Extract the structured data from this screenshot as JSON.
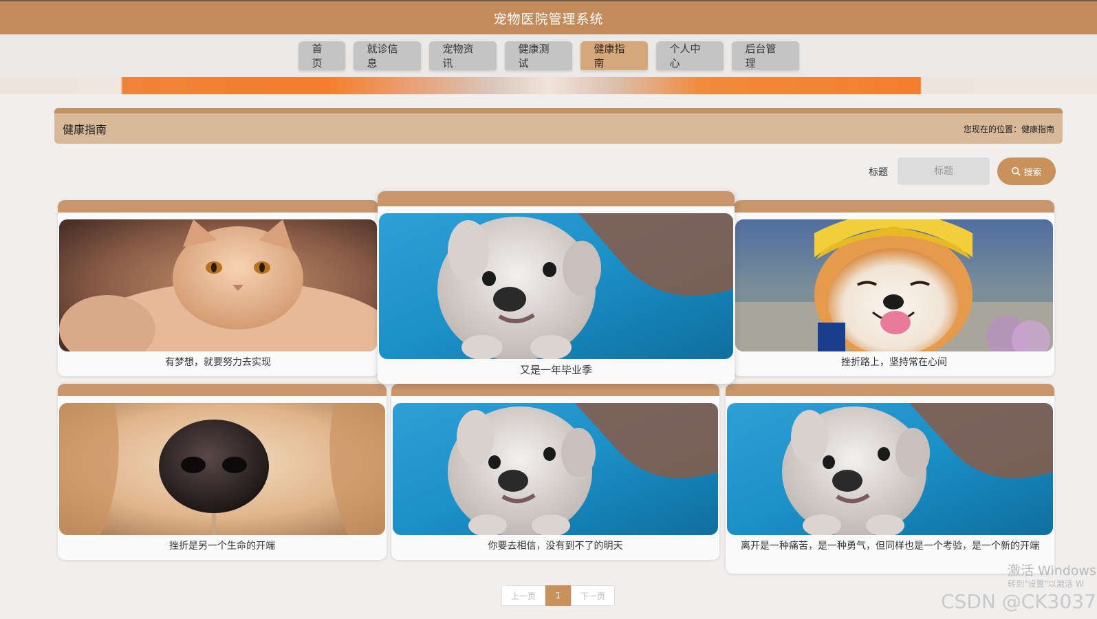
{
  "app": {
    "title": "宠物医院管理系统"
  },
  "nav": {
    "items": [
      "首页",
      "就诊信息",
      "宠物资讯",
      "健康测试",
      "健康指南",
      "个人中心",
      "后台管理"
    ],
    "active_index": 4
  },
  "section": {
    "title": "健康指南",
    "breadcrumb_prefix": "您现在的位置：",
    "breadcrumb_current": "健康指南"
  },
  "search": {
    "label": "标题",
    "placeholder": "标题",
    "button_label": "搜索"
  },
  "cards": [
    {
      "caption": "有梦想，就要努力去实现",
      "image": "orange-cat-photo"
    },
    {
      "caption": "又是一年毕业季",
      "image": "white-puppy-photo"
    },
    {
      "caption": "挫折路上，坚持常在心间",
      "image": "shiba-yellow-hat-photo"
    },
    {
      "caption": "挫折是另一个生命的开端",
      "image": "golden-retriever-nose-photo"
    },
    {
      "caption": "你要去相信，没有到不了的明天",
      "image": "white-puppy-photo"
    },
    {
      "caption": "离开是一种痛苦，是一种勇气，但同样也是一个考验，是一个新的开端",
      "image": "white-puppy-photo"
    }
  ],
  "pagination": {
    "prev": "上一页",
    "current": "1",
    "next": "下一页"
  },
  "overlay": {
    "activate_title": "激活 Windows",
    "activate_sub": "转到\"设置\"以激活 W",
    "watermark": "CSDN @CK3037"
  },
  "colors": {
    "primary": "#c48b5a",
    "nav_active": "#d4a87c",
    "header_band": "#d8b999",
    "card_top": "#c9956a"
  }
}
